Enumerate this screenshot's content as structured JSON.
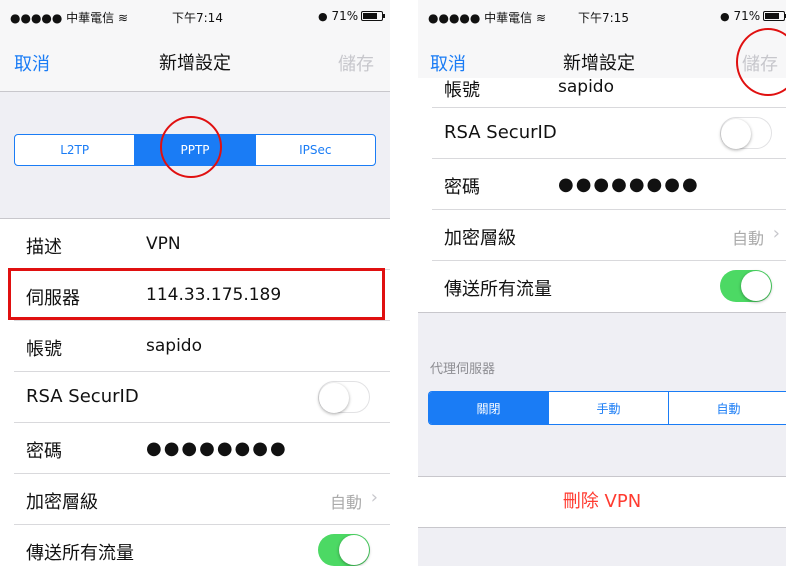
{
  "left": {
    "status": {
      "carrier": "●●●●● 中華電信 ",
      "time": "下午7:14",
      "battery": "71%"
    },
    "nav": {
      "cancel": "取消",
      "title": "新增設定",
      "save": "儲存"
    },
    "vpn_type": {
      "items": [
        "L2TP",
        "PPTP",
        "IPSec"
      ],
      "selected": "PPTP"
    },
    "rows": [
      {
        "label": "描述",
        "value": "VPN"
      },
      {
        "label": "伺服器",
        "value": "114.33.175.189"
      },
      {
        "label": "帳號",
        "value": "sapido"
      },
      {
        "label": "RSA SecurID",
        "toggle": false
      },
      {
        "label": "密碼",
        "value": "●●●●●●●●"
      },
      {
        "label": "加密層級",
        "detail": "自動"
      },
      {
        "label": "傳送所有流量",
        "toggle": true
      }
    ]
  },
  "right": {
    "status": {
      "carrier": "●●●●● 中華電信 ",
      "time": "下午7:15",
      "battery": "71%"
    },
    "nav": {
      "cancel": "取消",
      "title": "新增設定",
      "save": "儲存"
    },
    "rows": [
      {
        "label": "帳號",
        "value": "sapido"
      },
      {
        "label": "RSA SecurID",
        "toggle": false
      },
      {
        "label": "密碼",
        "value": "●●●●●●●●"
      },
      {
        "label": "加密層級",
        "detail": "自動"
      },
      {
        "label": "傳送所有流量",
        "toggle": true
      }
    ],
    "proxy": {
      "header": "代理伺服器",
      "items": [
        "關閉",
        "手動",
        "自動"
      ],
      "selected": "關閉"
    },
    "delete_label": "刪除 VPN"
  },
  "colors": {
    "accent": "#1a7cf5",
    "toggle_on": "#4cd964",
    "delete": "#ff3b30",
    "highlight": "#e01010"
  }
}
